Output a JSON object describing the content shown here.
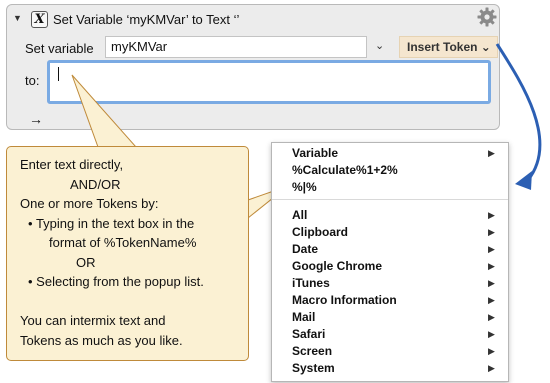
{
  "action": {
    "title": "Set Variable ‘myKMVar’ to Text ‘’",
    "icon_glyph": "X",
    "disclosure_icon": "triangle-down-icon",
    "set_variable_label": "Set variable",
    "variable_value": "myKMVar",
    "insert_token_label": "Insert Token",
    "to_label": "to:",
    "to_value": "",
    "arrow_glyph": "→",
    "colors": {
      "focus_ring": "#7aaae3",
      "token_button": "#f5e6cf",
      "connector_arrow": "#2c5fb3"
    }
  },
  "callout": {
    "lines": [
      "Enter text directly,",
      "AND/OR",
      "One or more Tokens by:",
      "Typing in the text box in the",
      "format of %TokenName%",
      "OR",
      "Selecting from the popup list.",
      "",
      "You can intermix text and",
      "Tokens as much as you like."
    ],
    "colors": {
      "background": "#fbf1d3",
      "border": "#bf8a3a"
    }
  },
  "token_menu": {
    "top_items": [
      {
        "label": "Variable",
        "submenu": true
      },
      {
        "label": "%Calculate%1+2%",
        "submenu": false
      },
      {
        "label": "%|%",
        "submenu": false
      }
    ],
    "items": [
      {
        "label": "All",
        "submenu": true
      },
      {
        "label": "Clipboard",
        "submenu": true
      },
      {
        "label": "Date",
        "submenu": true
      },
      {
        "label": "Google Chrome",
        "submenu": true
      },
      {
        "label": "iTunes",
        "submenu": true
      },
      {
        "label": "Macro Information",
        "submenu": true
      },
      {
        "label": "Mail",
        "submenu": true
      },
      {
        "label": "Safari",
        "submenu": true
      },
      {
        "label": "Screen",
        "submenu": true
      },
      {
        "label": "System",
        "submenu": true
      }
    ]
  }
}
